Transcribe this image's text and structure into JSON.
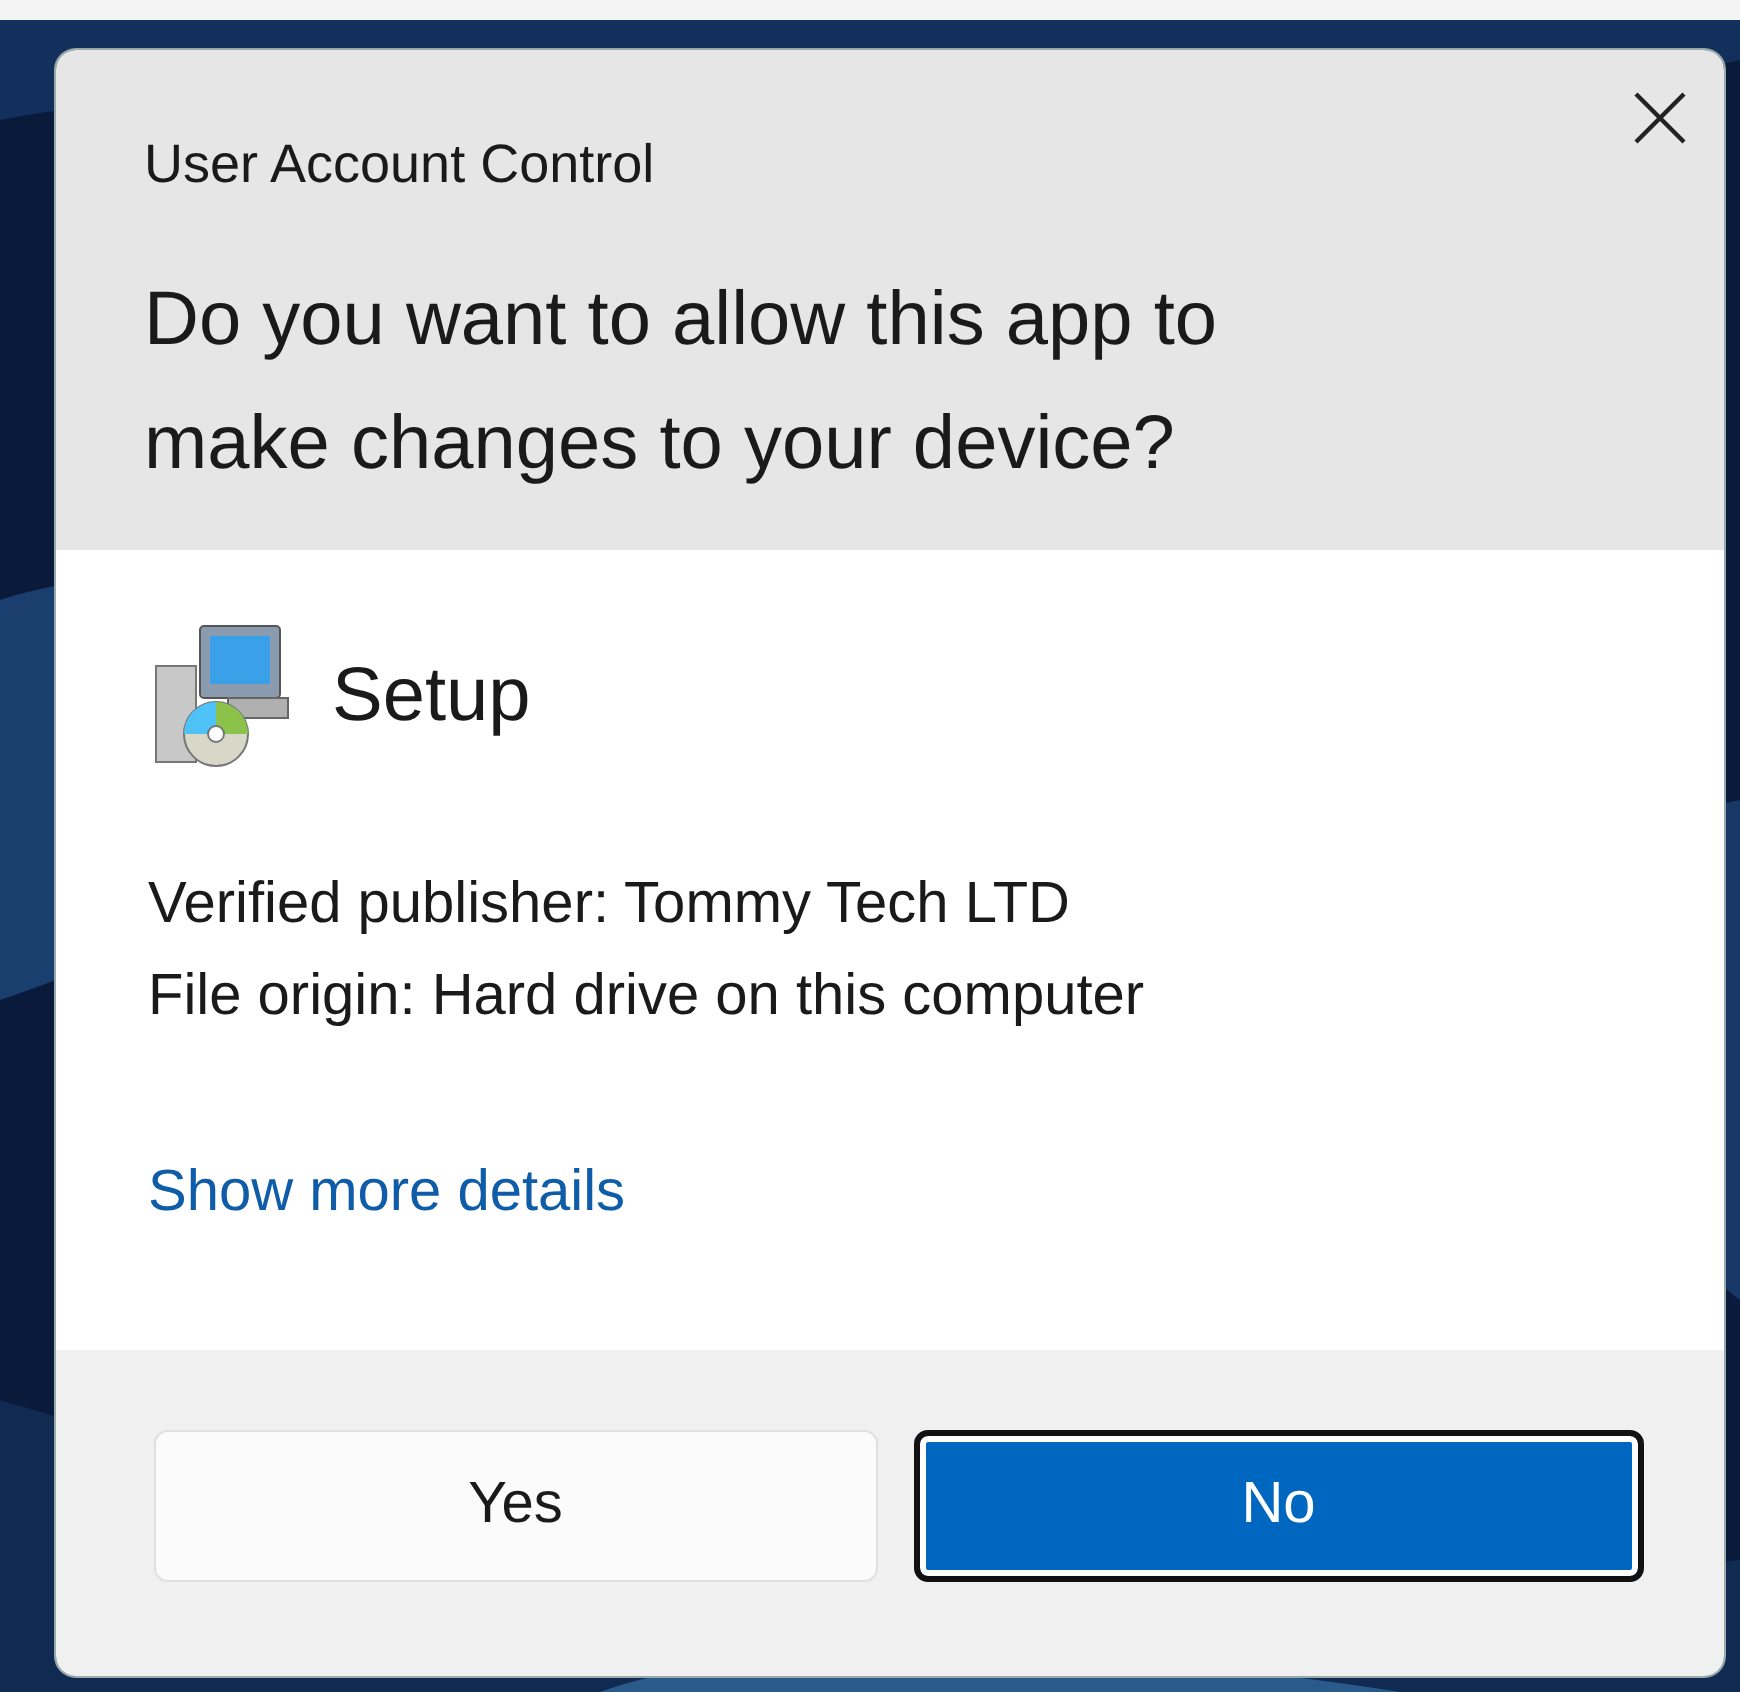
{
  "dialog": {
    "title": "User Account Control",
    "question": "Do you want to allow this app to make changes to your device?",
    "app": {
      "name": "Setup"
    },
    "details": [
      "Verified publisher: Tommy Tech LTD",
      "File origin: Hard drive on this computer"
    ],
    "link": "Show more details",
    "buttons": [
      {
        "label": "Yes",
        "kind": "secondary",
        "focused": false
      },
      {
        "label": "No",
        "kind": "primary",
        "focused": true
      }
    ]
  }
}
